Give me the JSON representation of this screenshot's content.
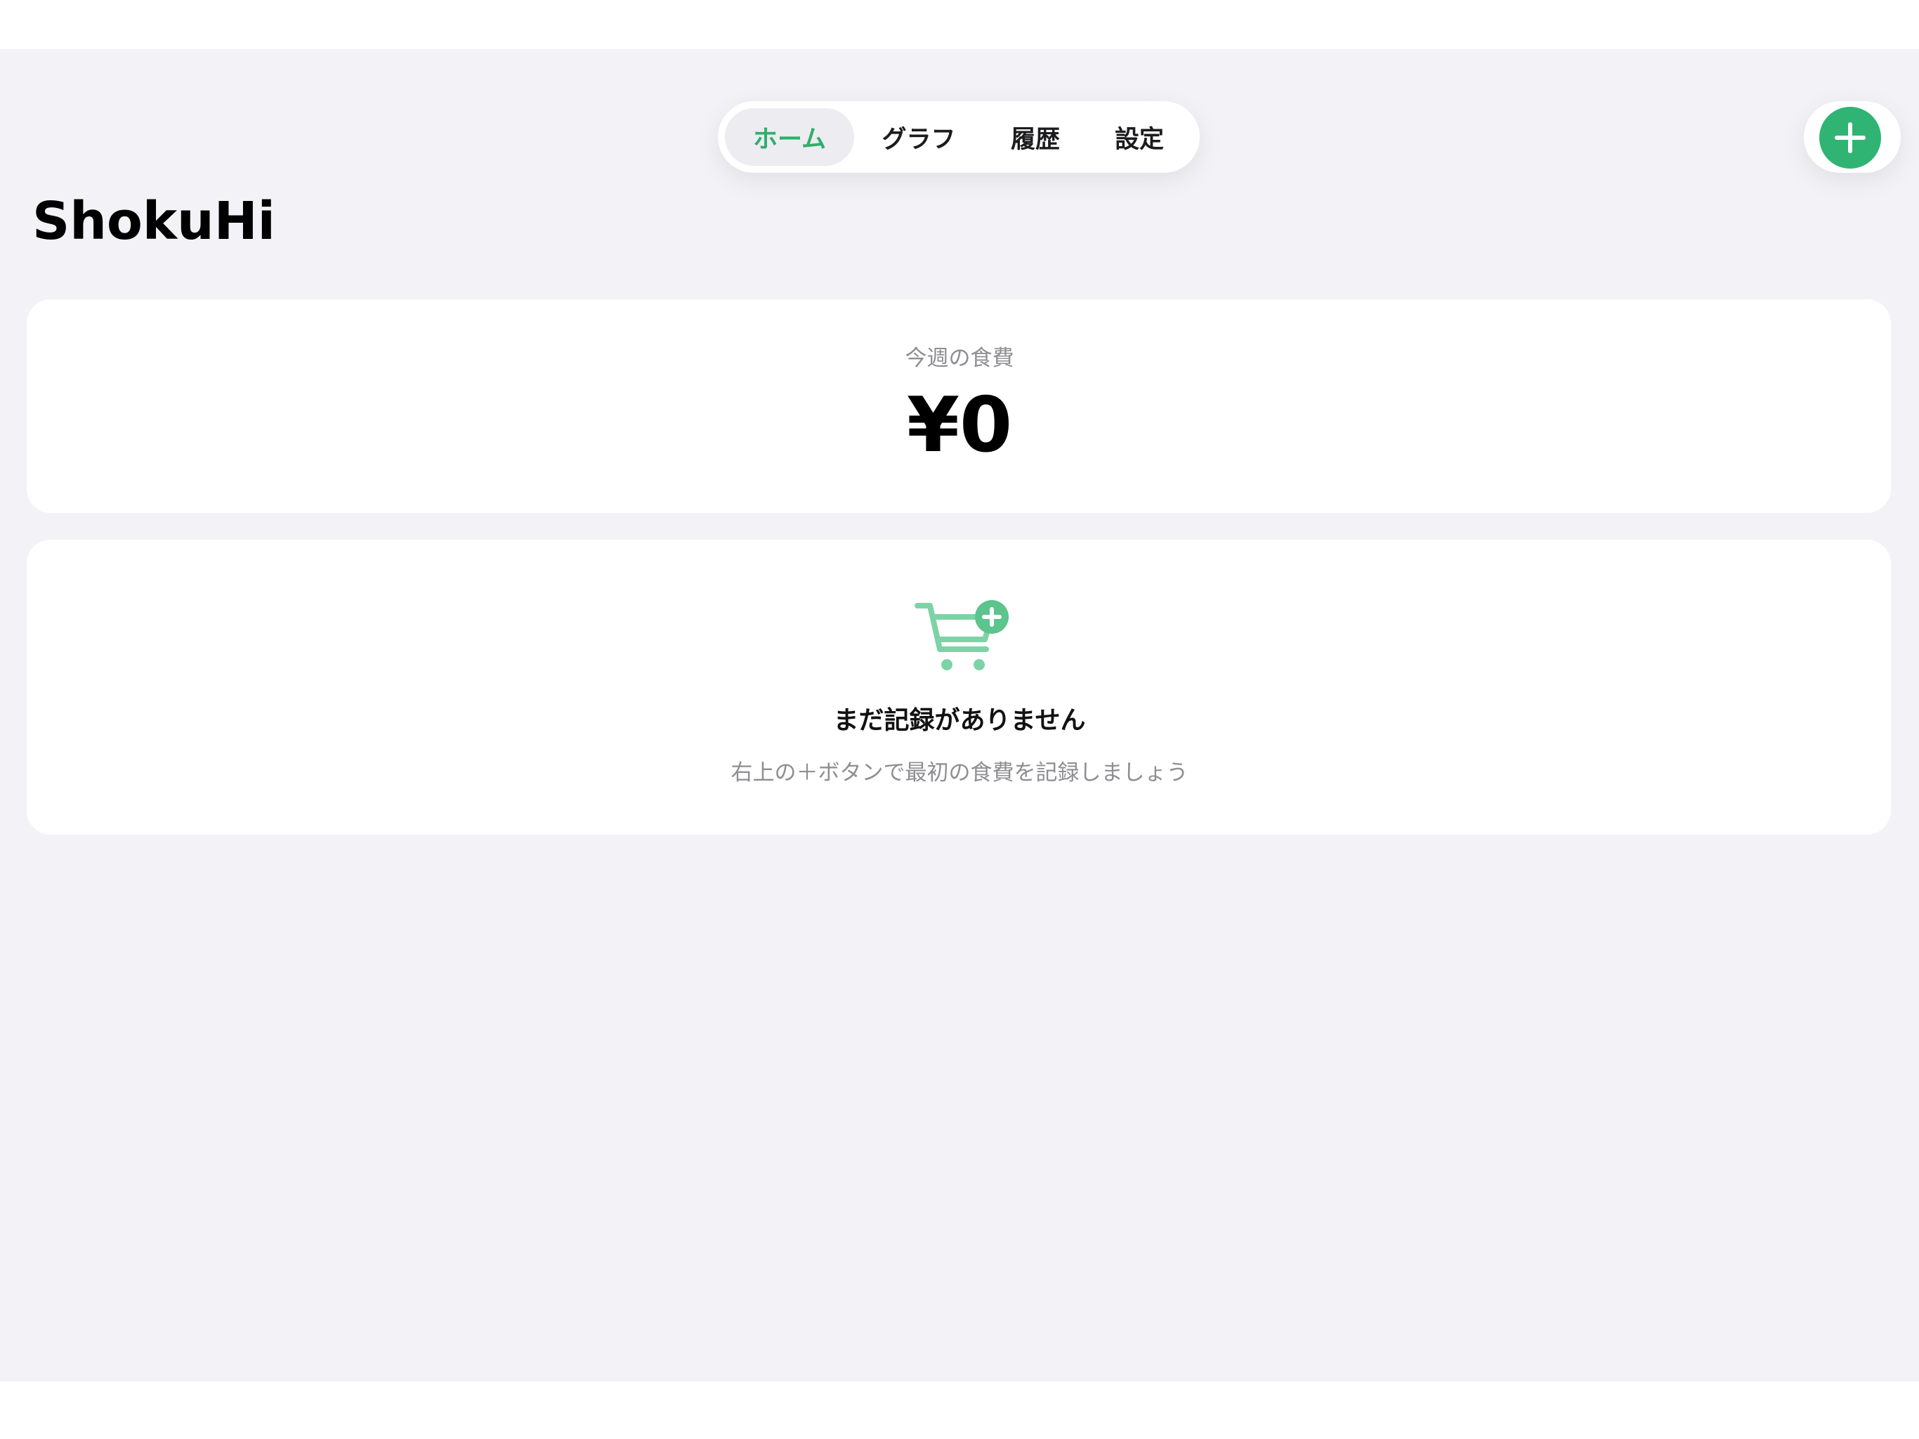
{
  "app": {
    "title": "ShokuHi"
  },
  "tabs": [
    {
      "label": "ホーム",
      "active": true
    },
    {
      "label": "グラフ",
      "active": false
    },
    {
      "label": "履歴",
      "active": false
    },
    {
      "label": "設定",
      "active": false
    }
  ],
  "header": {
    "add_button_icon": "plus-icon"
  },
  "summary": {
    "label": "今週の食費",
    "amount": "¥0"
  },
  "empty_state": {
    "icon": "cart-plus-icon",
    "title": "まだ記録がありません",
    "hint": "右上の＋ボタンで最初の食費を記録しましょう"
  },
  "colors": {
    "accent": "#2fb474",
    "background": "#f2f2f7",
    "card": "#ffffff",
    "secondary_text": "#8e8e93"
  }
}
